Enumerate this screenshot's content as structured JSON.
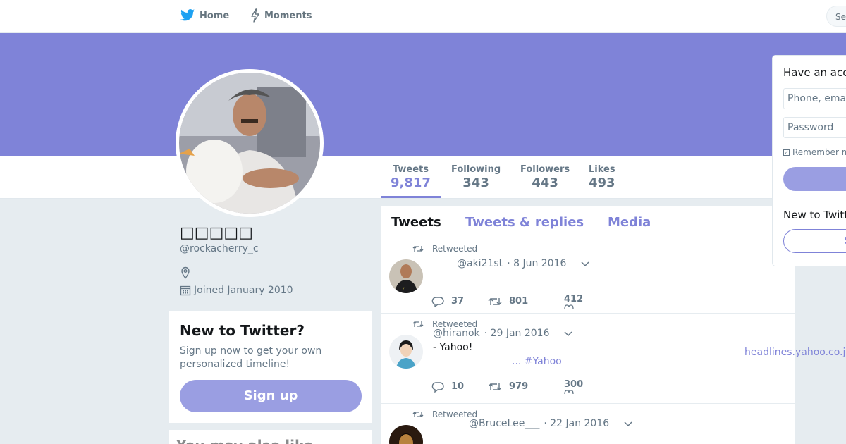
{
  "colors": {
    "accent": "#7f83d8",
    "banner": "#7f83d8",
    "text_muted": "#657786"
  },
  "nav": {
    "home": {
      "label": "Home",
      "icon": "bird-icon"
    },
    "moments": {
      "label": "Moments",
      "icon": "lightning-icon"
    },
    "search_placeholder": "Se",
    "top_right_fragment": "H"
  },
  "stats": [
    {
      "label": "Tweets",
      "value": "9,817"
    },
    {
      "label": "Following",
      "value": "343"
    },
    {
      "label": "Followers",
      "value": "443"
    },
    {
      "label": "Likes",
      "value": "493"
    }
  ],
  "profile": {
    "display_name": "□□□□□",
    "handle": "@rockacherry_c",
    "joined": "Joined January 2010"
  },
  "signup_card": {
    "title": "New to Twitter?",
    "text": "Sign up now to get your own personalized timeline!",
    "button": "Sign up"
  },
  "next_card": {
    "title": "You may also like"
  },
  "timeline": {
    "tabs": [
      "Tweets",
      "Tweets & replies",
      "Media"
    ],
    "tweets": [
      {
        "retweeted_label": "Retweeted",
        "handle": "@aki21st",
        "date": "· 8 Jun 2016",
        "text": "",
        "replies": "37",
        "retweets": "801",
        "likes": "412"
      },
      {
        "retweeted_label": "Retweeted",
        "handle": "@hiranok",
        "date": "· 29 Jan 2016",
        "text": "- Yahoo!",
        "link_text": "... #Yahoo",
        "link_right": "headlines.yahoo.co.jp",
        "replies": "10",
        "retweets": "979",
        "likes": "300"
      },
      {
        "retweeted_label": "Retweeted",
        "handle": "@BruceLee___",
        "date": "· 22 Jan 2016"
      }
    ]
  },
  "login": {
    "title": "Have an account?",
    "phone_placeholder": "Phone, email",
    "password_placeholder": "Password",
    "remember": "Remember me",
    "new_label": "New to Twitter?",
    "signup_fragment": "S"
  }
}
